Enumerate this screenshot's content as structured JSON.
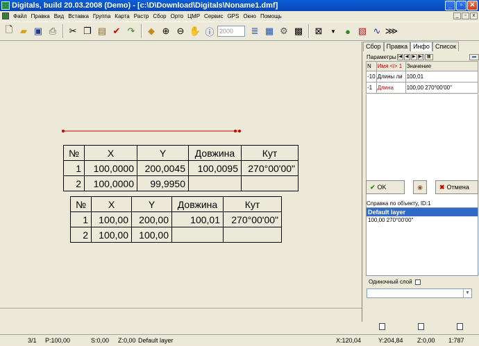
{
  "window": {
    "title": "Digitals, build 20.03.2008 (Demo) - [c:\\D\\Download\\Digitals\\Noname1.dmf]"
  },
  "menu": [
    "Файл",
    "Правка",
    "Вид",
    "Вставка",
    "Группа",
    "Карта",
    "Растр",
    "Сбор",
    "Орто",
    "ЦМР",
    "Сервис",
    "GPS",
    "Окно",
    "Помощь"
  ],
  "toolbar": {
    "scale_input": "2000"
  },
  "table1": {
    "headers": [
      "№",
      "X",
      "Y",
      "Довжина",
      "Кут"
    ],
    "rows": [
      [
        "1",
        "100,0000",
        "200,0045",
        "100,0095",
        "270°00'00\""
      ],
      [
        "2",
        "100,0000",
        "99,9950",
        "",
        ""
      ]
    ]
  },
  "table2": {
    "headers": [
      "№",
      "X",
      "Y",
      "Довжина",
      "Кут"
    ],
    "rows": [
      [
        "1",
        "100,00",
        "200,00",
        "100,01",
        "270°00'00\""
      ],
      [
        "2",
        "100,00",
        "100,00",
        "",
        ""
      ]
    ]
  },
  "panel": {
    "tabs": [
      "Сбор",
      "Правка",
      "Инфо",
      "Список"
    ],
    "active_tab": "Инфо",
    "params_label": "Параметры",
    "columns": [
      "N",
      "Имя <i> 1",
      "Значение"
    ],
    "rows": [
      [
        "-10",
        "Длины ли",
        "100,01"
      ],
      [
        "-1",
        "Длина",
        "100,00 270°00'00\""
      ]
    ],
    "ok_label": "OK",
    "cancel_label": "Отмена",
    "help_label": "Справка по объекту, ID:1",
    "layer_title": "Default layer",
    "layer_value": "100,00 270°00'00\"",
    "single_layer_label": "Одиночный слой"
  },
  "status": {
    "index": "3/1",
    "perimeter": "P:100,00",
    "area": "S:0,00",
    "z": "Z:0,00",
    "layer": "Default layer",
    "x": "X:120,04",
    "y": "Y:204,84",
    "z2": "Z:0,00",
    "scale": "1:787"
  },
  "colors": {
    "title_bar": "#0a5fd8",
    "line": "#cc0000",
    "highlight": "#316ac5"
  }
}
